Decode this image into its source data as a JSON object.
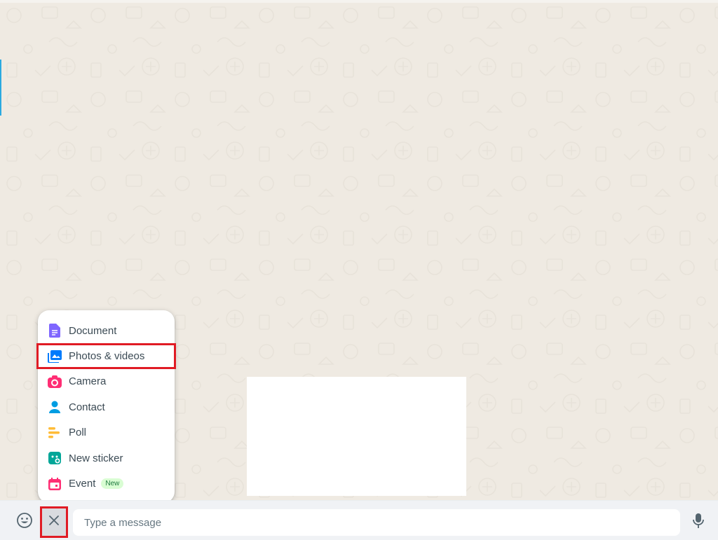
{
  "attach_menu": {
    "items": [
      {
        "label": "Document",
        "icon": "document-icon",
        "color": "#7f66ff"
      },
      {
        "label": "Photos & videos",
        "icon": "photos-videos-icon",
        "color": "#007bfc"
      },
      {
        "label": "Camera",
        "icon": "camera-icon",
        "color": "#ff2e74"
      },
      {
        "label": "Contact",
        "icon": "contact-icon",
        "color": "#009de2"
      },
      {
        "label": "Poll",
        "icon": "poll-icon",
        "color": "#ffbc38"
      },
      {
        "label": "New sticker",
        "icon": "sticker-icon",
        "color": "#02a698"
      },
      {
        "label": "Event",
        "icon": "event-icon",
        "color": "#ff2e74",
        "badge": "New"
      }
    ],
    "highlighted_item": "Photos & videos"
  },
  "composer": {
    "placeholder": "Type a message",
    "close_glyph": "✕"
  },
  "colors": {
    "wallpaper": "#efeae2",
    "highlight": "#e01b24",
    "composer_bg": "#f0f2f5"
  }
}
